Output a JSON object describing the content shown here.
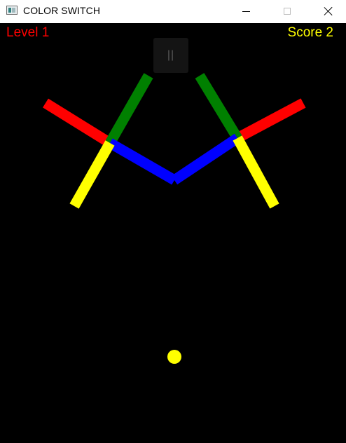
{
  "window": {
    "title": "COLOR SWITCH",
    "minimize_icon": "minimize-icon",
    "maximize_icon": "maximize-icon",
    "close_icon": "close-icon"
  },
  "hud": {
    "level_label": "Level 1",
    "score_label": "Score 2",
    "pause_label": "||"
  },
  "colors": {
    "background": "#000000",
    "red": "#ff0000",
    "green": "#008000",
    "blue": "#0000ff",
    "yellow": "#ffff00"
  },
  "obstacle": {
    "type": "double-cross",
    "segment_colors": [
      "red",
      "green",
      "blue",
      "yellow"
    ]
  },
  "player_ball": {
    "color": "yellow"
  }
}
